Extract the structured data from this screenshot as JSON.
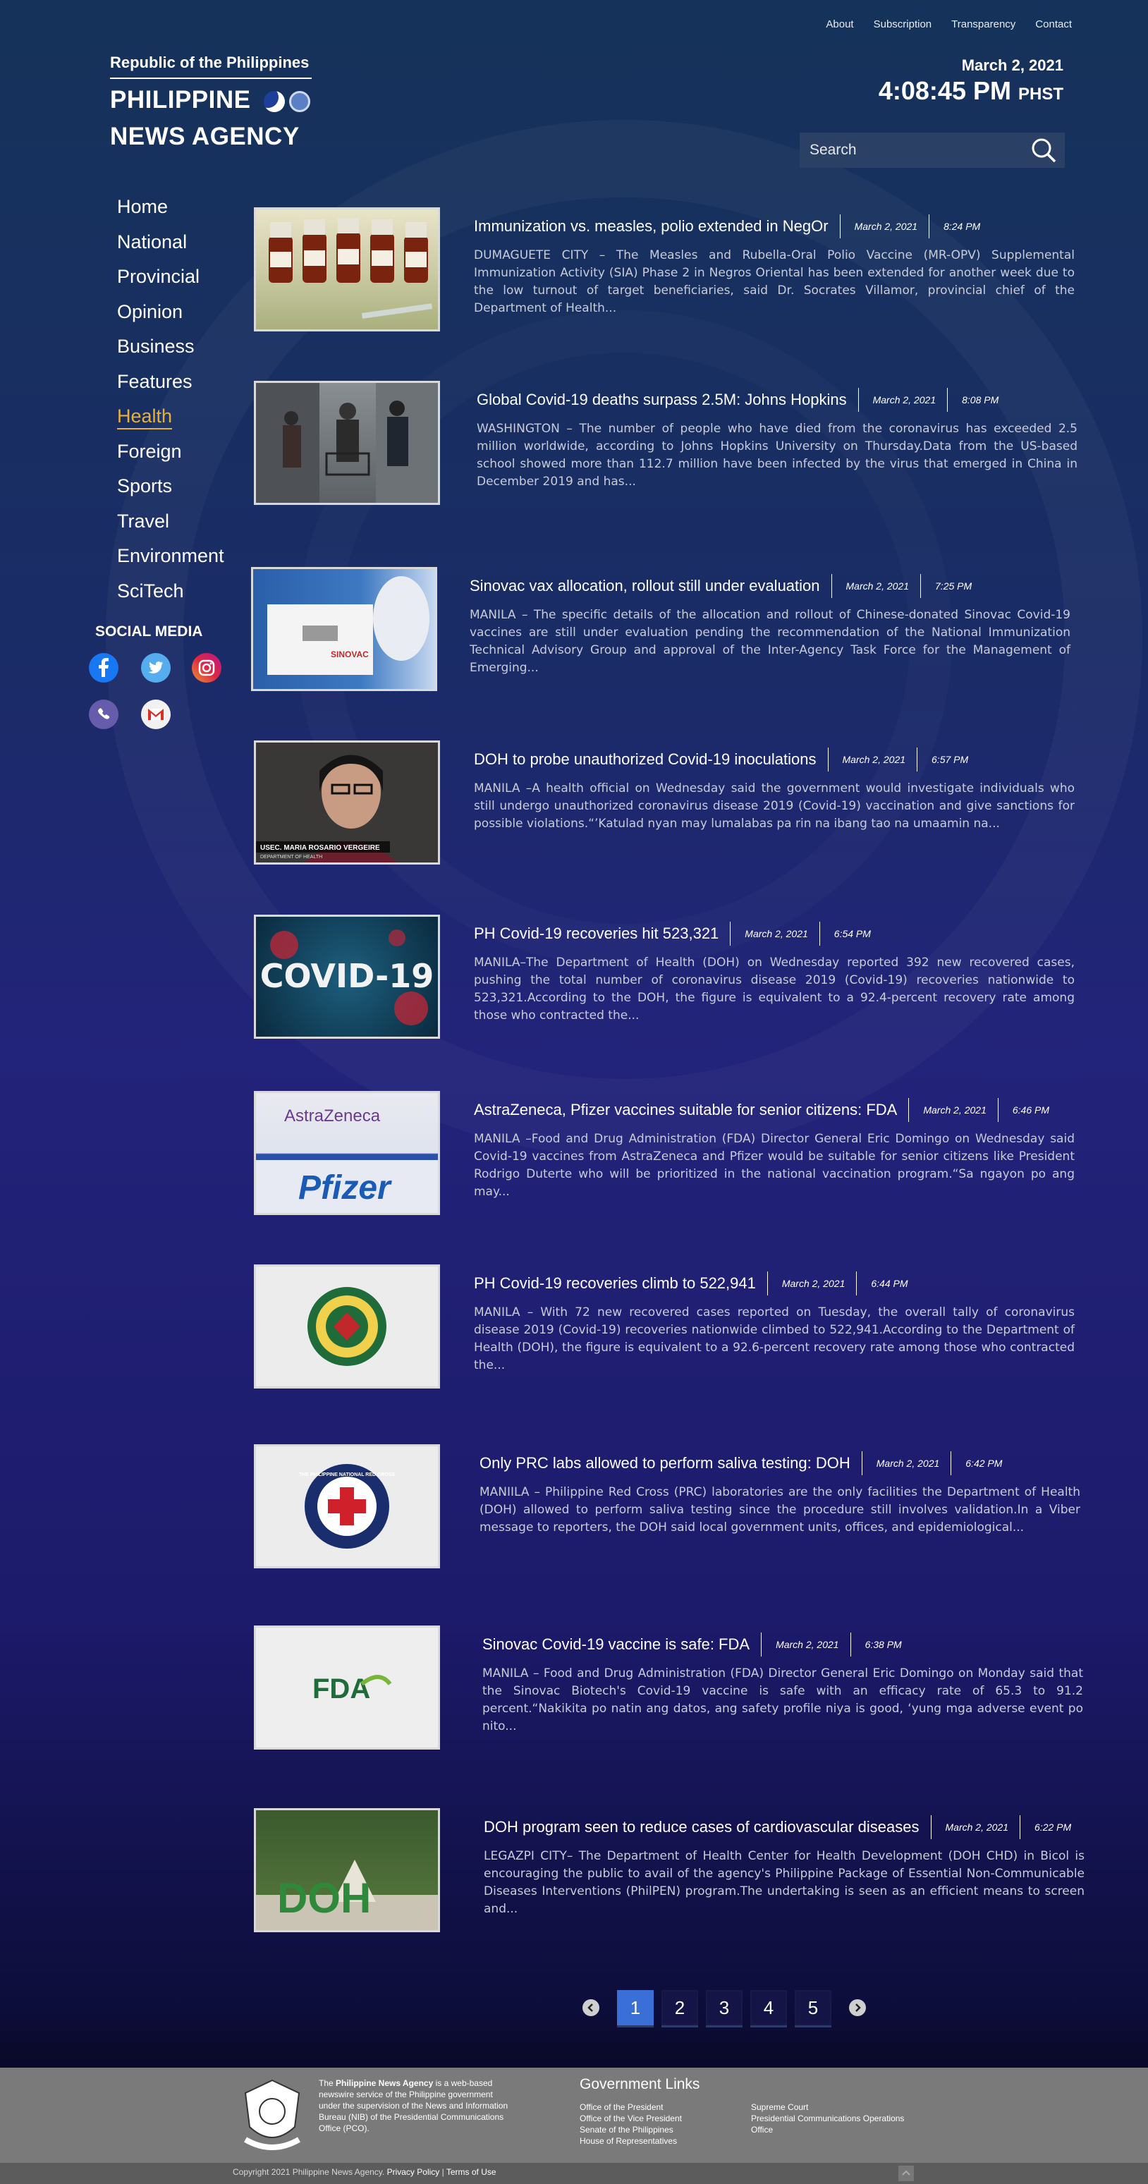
{
  "topnav": [
    "About",
    "Subscription",
    "Transparency",
    "Contact"
  ],
  "logo": {
    "line1": "Republic of the Philippines",
    "line2": "PHILIPPINE",
    "line3": "NEWS AGENCY"
  },
  "header": {
    "date": "March 2, 2021",
    "time": "4:08:45 PM",
    "tz": "PHST"
  },
  "search": {
    "placeholder": "Search"
  },
  "nav": [
    "Home",
    "National",
    "Provincial",
    "Opinion",
    "Business",
    "Features",
    "Health",
    "Foreign",
    "Sports",
    "Travel",
    "Environment",
    "SciTech"
  ],
  "nav_active": "Health",
  "social": {
    "title": "SOCIAL MEDIA",
    "icons": [
      "facebook-icon",
      "twitter-icon",
      "instagram-icon",
      "viber-icon",
      "gmail-icon"
    ]
  },
  "articles": [
    {
      "title": "Immunization vs. measles, polio extended in NegOr",
      "date": "March 2, 2021",
      "time": "8:24 PM",
      "excerpt": "DUMAGUETE CITY – The Measles and Rubella-Oral Polio Vaccine (MR-OPV) Supplemental Immunization Activity (SIA) Phase 2 in Negros Oriental has been extended for another week due to the low turnout of target beneficiaries, said Dr. Socrates Villamor, provincial chief of the Department of Health..."
    },
    {
      "title": "Global Covid-19 deaths surpass 2.5M: Johns Hopkins",
      "date": "March 2, 2021",
      "time": "8:08 PM",
      "excerpt": "WASHINGTON – The number of people who have died from the coronavirus has exceeded 2.5 million worldwide, according to Johns Hopkins University on Thursday.Data from the US-based school showed more than 112.7 million have been infected by the virus that emerged in China in December 2019 and has..."
    },
    {
      "title": "Sinovac vax allocation, rollout still under evaluation",
      "date": "March 2, 2021",
      "time": "7:25 PM",
      "excerpt": "MANILA – The specific details of the allocation and rollout of Chinese-donated Sinovac Covid-19 vaccines are still under evaluation pending the recommendation of the National Immunization Technical Advisory Group and approval of the Inter-Agency Task Force for the Management of Emerging..."
    },
    {
      "title": "DOH to probe unauthorized Covid-19 inoculations",
      "date": "March 2, 2021",
      "time": "6:57 PM",
      "excerpt": "MANILA –A health official on Wednesday said the government would investigate individuals who still undergo unauthorized coronavirus disease 2019 (Covid-19) vaccination and give sanctions for possible violations.“’Katulad nyan may lumalabas pa rin na ibang tao na umaamin na..."
    },
    {
      "title": "PH Covid-19 recoveries hit 523,321",
      "date": "March 2, 2021",
      "time": "6:54 PM",
      "excerpt": "MANILA–The Department of Health (DOH) on Wednesday reported 392 new recovered cases, pushing the total number of coronavirus disease 2019 (Covid-19) recoveries nationwide to 523,321.According to the DOH, the figure is equivalent to a 92.4-percent recovery rate among those who contracted the..."
    },
    {
      "title": "AstraZeneca, Pfizer vaccines suitable for senior citizens: FDA",
      "date": "March 2, 2021",
      "time": "6:46 PM",
      "excerpt": "MANILA –Food and Drug Administration (FDA) Director General Eric Domingo on Wednesday said Covid-19 vaccines from AstraZeneca and Pfizer would be suitable for senior citizens like President Rodrigo Duterte who will be prioritized in the national vaccination program.“Sa ngayon po ang may..."
    },
    {
      "title": "PH Covid-19 recoveries climb to 522,941",
      "date": "March 2, 2021",
      "time": "6:44 PM",
      "excerpt": "MANILA – With 72 new recovered cases reported on Tuesday, the overall tally of coronavirus disease 2019 (Covid-19) recoveries nationwide climbed to 522,941.According to the Department of Health (DOH), the figure is equivalent to a 92.6-percent recovery rate among those who contracted the..."
    },
    {
      "title": "Only PRC labs allowed to perform saliva testing: DOH",
      "date": "March 2, 2021",
      "time": "6:42 PM",
      "excerpt": "MANIILA – Philippine Red Cross (PRC) laboratories are the only facilities the Department of Health (DOH) allowed to perform saliva testing since the procedure still involves validation.In a Viber message to reporters, the DOH said local government units, offices, and epidemiological..."
    },
    {
      "title": "Sinovac Covid-19 vaccine is safe: FDA",
      "date": "March 2, 2021",
      "time": "6:38 PM",
      "excerpt": "MANILA – Food and Drug Administration (FDA) Director General Eric Domingo on Monday said that the Sinovac Biotech's Covid-19 vaccine is safe with an efficacy rate of 65.3 to 91.2 percent.“Nakikita po natin ang datos, ang safety profile niya is good, ‘yung mga adverse event po nito..."
    },
    {
      "title": "DOH program seen to reduce cases of cardiovascular diseases",
      "date": "March 2, 2021",
      "time": "6:22 PM",
      "excerpt": "LEGAZPI CITY– The Department of Health Center for Health Development (DOH CHD) in Bicol is encouraging the public to avail of the agency's Philippine Package of Essential Non-Communicable Diseases Interventions (PhilPEN) program.The undertaking is seen as an efficient means to screen and..."
    }
  ],
  "thumb_text": {
    "covid": "COVID-19",
    "astra": "AstraZeneca",
    "pfizer": "Pfizer",
    "fda": "FDA",
    "doh": "DOH",
    "usec": "USEC. MARIA ROSARIO VERGEIRE",
    "usec_dept": "DEPARTMENT OF HEALTH",
    "redcross": "THE PHILIPPINE NATIONAL RED CROSS",
    "sinovac_box": "SINOVAC"
  },
  "pager": {
    "pages": [
      "1",
      "2",
      "3",
      "4",
      "5"
    ],
    "current": "1"
  },
  "footer": {
    "about_pre": "The ",
    "about_bold": "Philippine News Agency",
    "about_post": " is a web-based newswire service of the Philippine government under the supervision of the News and Information Bureau (NIB) of the Presidential Communications Office (PCO).",
    "gov_title": "Government Links",
    "links_col1": [
      "Office of the President",
      "Office of the Vice President",
      "Senate of the Philippines",
      "House of Representatives"
    ],
    "links_col2": [
      "Supreme Court",
      "Presidential Communications Operations",
      "Office"
    ],
    "copyright": "Copyright 2021 Philippine News Agency.",
    "privacy": "Privacy Policy",
    "sep": "|",
    "terms": "Terms of Use"
  }
}
